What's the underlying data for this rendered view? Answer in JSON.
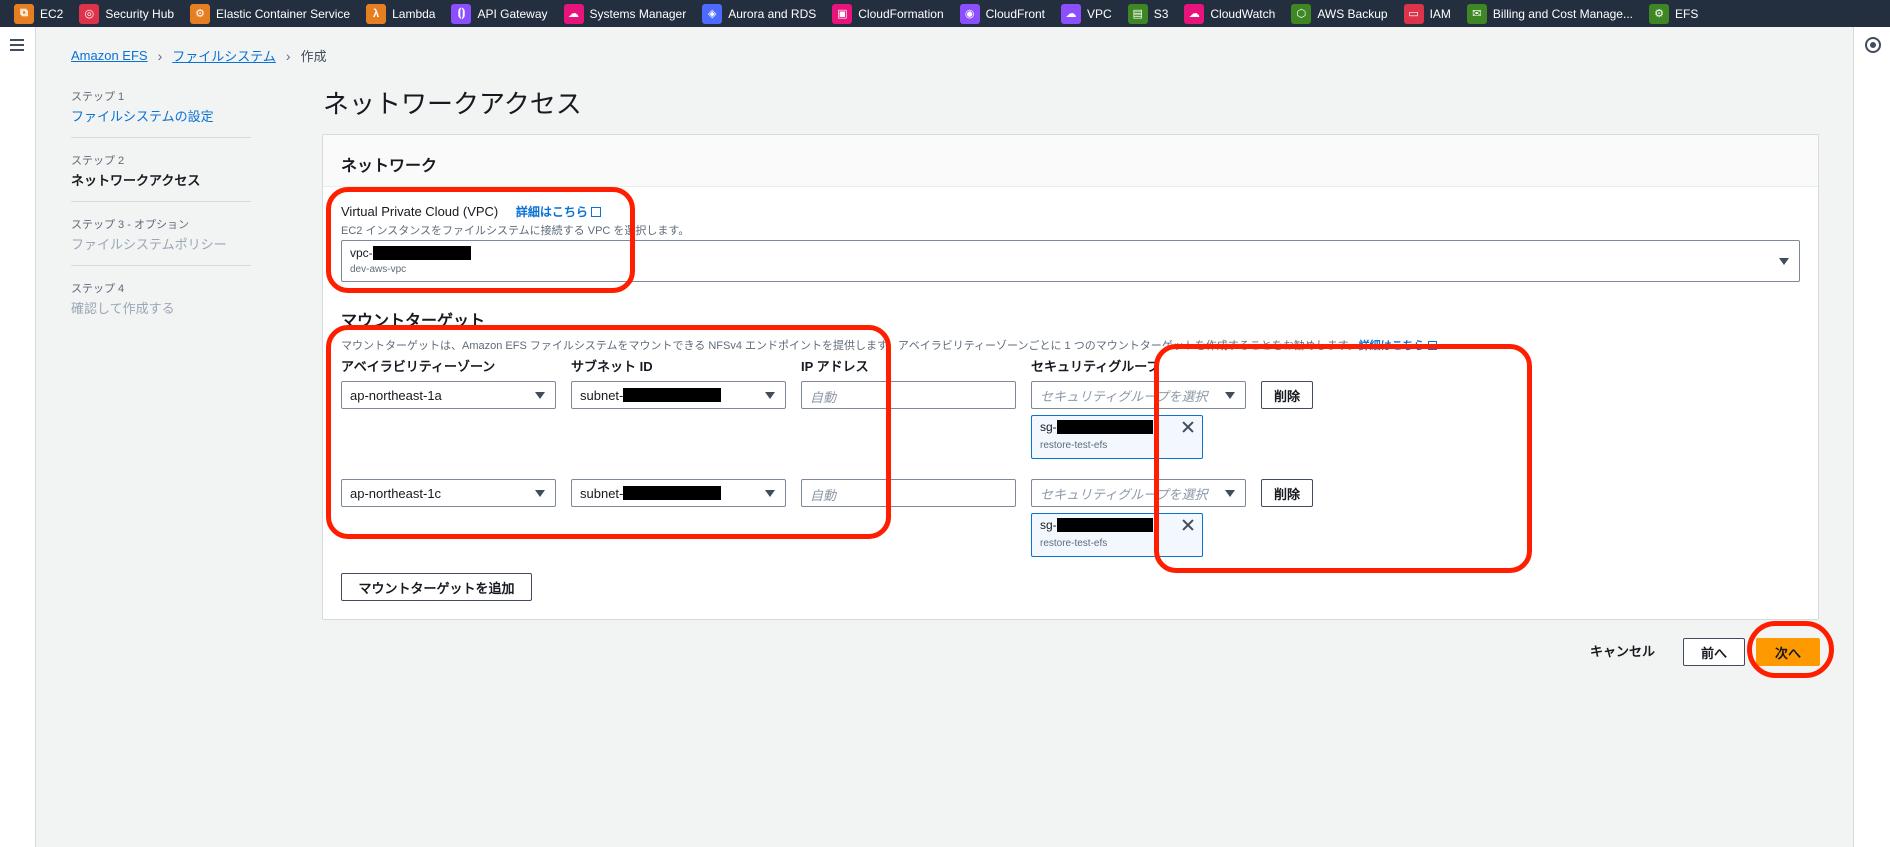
{
  "favorites": [
    {
      "label": "EC2",
      "icon": "ec2-icon",
      "color": "#e67e22",
      "glyph": "⧉"
    },
    {
      "label": "Security Hub",
      "icon": "security-hub-icon",
      "color": "#dd344c",
      "glyph": "◎"
    },
    {
      "label": "Elastic Container Service",
      "icon": "ecs-icon",
      "color": "#e67e22",
      "glyph": "⚙"
    },
    {
      "label": "Lambda",
      "icon": "lambda-icon",
      "color": "#e67e22",
      "glyph": "λ"
    },
    {
      "label": "API Gateway",
      "icon": "api-gateway-icon",
      "color": "#8c4fff",
      "glyph": "⦗⦘"
    },
    {
      "label": "Systems Manager",
      "icon": "systems-manager-icon",
      "color": "#e7157b",
      "glyph": "☁"
    },
    {
      "label": "Aurora and RDS",
      "icon": "rds-icon",
      "color": "#4d6bfe",
      "glyph": "◈"
    },
    {
      "label": "CloudFormation",
      "icon": "cloudformation-icon",
      "color": "#e7157b",
      "glyph": "▣"
    },
    {
      "label": "CloudFront",
      "icon": "cloudfront-icon",
      "color": "#8c4fff",
      "glyph": "◉"
    },
    {
      "label": "VPC",
      "icon": "vpc-icon",
      "color": "#8c4fff",
      "glyph": "☁"
    },
    {
      "label": "S3",
      "icon": "s3-icon",
      "color": "#3f8624",
      "glyph": "▤"
    },
    {
      "label": "CloudWatch",
      "icon": "cloudwatch-icon",
      "color": "#e7157b",
      "glyph": "☁"
    },
    {
      "label": "AWS Backup",
      "icon": "backup-icon",
      "color": "#3f8624",
      "glyph": "⬡"
    },
    {
      "label": "IAM",
      "icon": "iam-icon",
      "color": "#dd344c",
      "glyph": "▭"
    },
    {
      "label": "Billing and Cost Manage...",
      "icon": "billing-icon",
      "color": "#3f8624",
      "glyph": "✉"
    },
    {
      "label": "EFS",
      "icon": "efs-icon",
      "color": "#3f8624",
      "glyph": "⚙"
    }
  ],
  "breadcrumb": {
    "root": "Amazon EFS",
    "parent": "ファイルシステム",
    "current": "作成"
  },
  "steps": [
    {
      "num": "ステップ 1",
      "label": "ファイルシステムの設定"
    },
    {
      "num": "ステップ 2",
      "label": "ネットワークアクセス"
    },
    {
      "num": "ステップ 3 - オプション",
      "label": "ファイルシステムポリシー"
    },
    {
      "num": "ステップ 4",
      "label": "確認して作成する"
    }
  ],
  "page_title": "ネットワークアクセス",
  "network": {
    "header": "ネットワーク",
    "vpc_label": "Virtual Private Cloud (VPC)",
    "info_link": "詳細はこちら",
    "vpc_desc": "EC2 インスタンスをファイルシステムに接続する VPC を選択します。",
    "vpc_prefix": "vpc-",
    "vpc_name": "dev-aws-vpc"
  },
  "mount": {
    "title": "マウントターゲット",
    "desc": "マウントターゲットは、Amazon EFS ファイルシステムをマウントできる NFSv4 エンドポイントを提供します。アベイラビリティーゾーンごとに 1 つのマウントターゲットを作成することをお勧めします。",
    "desc_link": "詳細はこちら",
    "col_az": "アベイラビリティーゾーン",
    "col_subnet": "サブネット ID",
    "col_ip": "IP アドレス",
    "col_sg": "セキュリティグループ",
    "ip_placeholder": "自動",
    "sg_placeholder": "セキュリティグループを選択",
    "remove_label": "削除",
    "add_label": "マウントターゲットを追加",
    "rows": [
      {
        "az": "ap-northeast-1a",
        "subnet_prefix": "subnet-",
        "sg_prefix": "sg-",
        "sg_name": "restore-test-efs"
      },
      {
        "az": "ap-northeast-1c",
        "subnet_prefix": "subnet-",
        "sg_prefix": "sg-",
        "sg_name": "restore-test-efs"
      }
    ]
  },
  "footer": {
    "cancel": "キャンセル",
    "prev": "前へ",
    "next": "次へ"
  },
  "colors": {
    "accent": "#ff9900",
    "link": "#0972d3",
    "highlight": "#ff1f00"
  }
}
